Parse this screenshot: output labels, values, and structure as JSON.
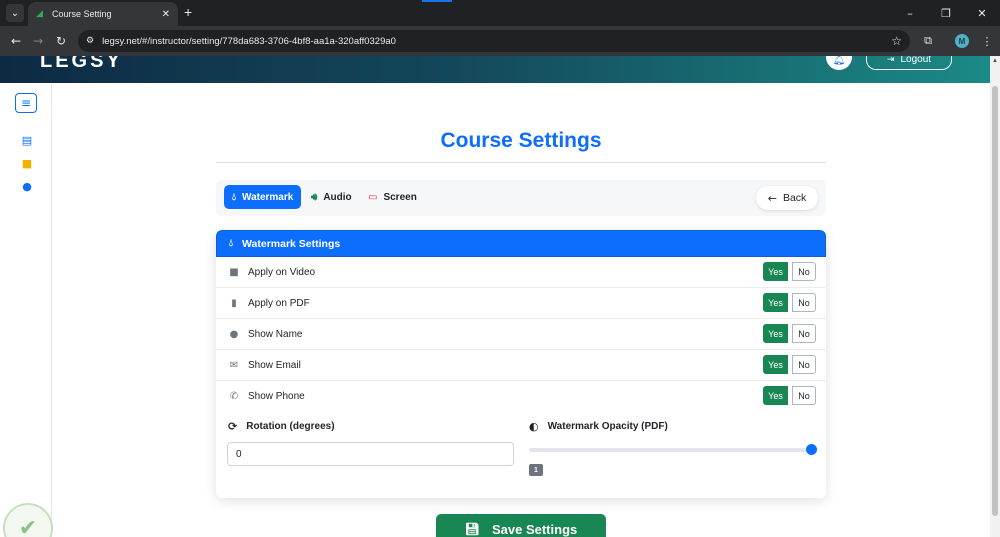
{
  "browser": {
    "tab_title": "Course Setting",
    "tab_close": "✕",
    "new_tab": "+",
    "url": "legsy.net/#/instructor/setting/778da683-3706-4bf8-aa1a-320aff0329a0",
    "profile_initial": "M",
    "window_buttons": [
      "–",
      "❐",
      "✕"
    ]
  },
  "header": {
    "logo": "LEGSY",
    "logout_label": "Logout"
  },
  "page": {
    "title": "Course Settings"
  },
  "tabs": [
    {
      "label": "Watermark",
      "icon": "droplet-icon",
      "active": true
    },
    {
      "label": "Audio",
      "icon": "volume-icon",
      "active": false
    },
    {
      "label": "Screen",
      "icon": "monitor-icon",
      "active": false
    }
  ],
  "back_label": "Back",
  "watermark": {
    "header": "Watermark Settings",
    "options": [
      {
        "label": "Apply on Video",
        "icon": "video-icon",
        "value": "Yes"
      },
      {
        "label": "Apply on PDF",
        "icon": "pdf-icon",
        "value": "Yes"
      },
      {
        "label": "Show Name",
        "icon": "user-icon",
        "value": "Yes"
      },
      {
        "label": "Show Email",
        "icon": "envelope-icon",
        "value": "Yes"
      },
      {
        "label": "Show Phone",
        "icon": "phone-icon",
        "value": "Yes"
      }
    ],
    "yes_label": "Yes",
    "no_label": "No",
    "rotation_label": "Rotation (degrees)",
    "rotation_value": "0",
    "opacity_label": "Watermark Opacity (PDF)",
    "opacity_value": "1",
    "opacity_fraction": 1
  },
  "save_label": "Save Settings",
  "colors": {
    "primary": "#0d6efd",
    "success": "#198754"
  }
}
